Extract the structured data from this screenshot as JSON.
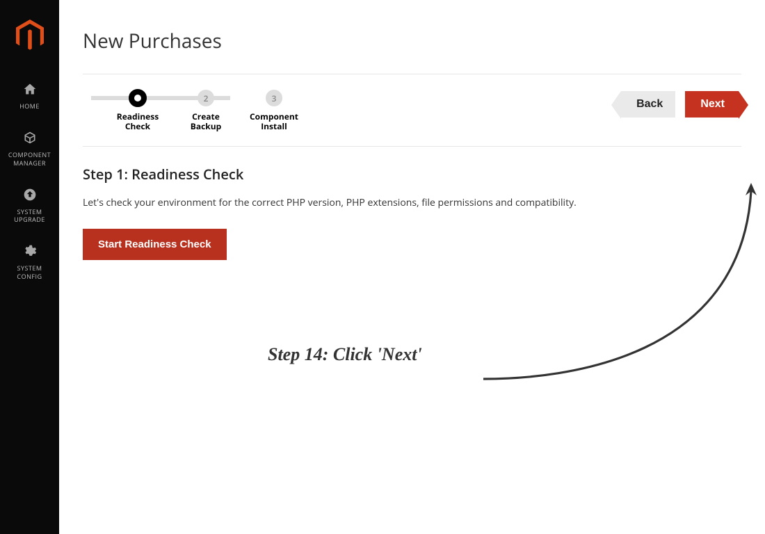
{
  "sidebar": {
    "items": [
      {
        "label": "HOME"
      },
      {
        "label": "COMPONENT\nMANAGER"
      },
      {
        "label": "SYSTEM\nUPGRADE"
      },
      {
        "label": "SYSTEM\nCONFIG"
      }
    ]
  },
  "header": {
    "title": "New Purchases"
  },
  "wizard": {
    "steps": [
      {
        "label": "Readiness\nCheck",
        "num": "1"
      },
      {
        "label": "Create\nBackup",
        "num": "2"
      },
      {
        "label": "Component\nInstall",
        "num": "3"
      }
    ],
    "back_label": "Back",
    "next_label": "Next"
  },
  "content": {
    "heading": "Step 1: Readiness Check",
    "description": "Let's check your environment for the correct PHP version, PHP extensions, file permissions and compatibility.",
    "start_button": "Start Readiness Check"
  },
  "annotation": {
    "text": "Step 14: Click 'Next'"
  },
  "colors": {
    "accent": "#c5321f",
    "sidebar": "#0a0a0a"
  }
}
